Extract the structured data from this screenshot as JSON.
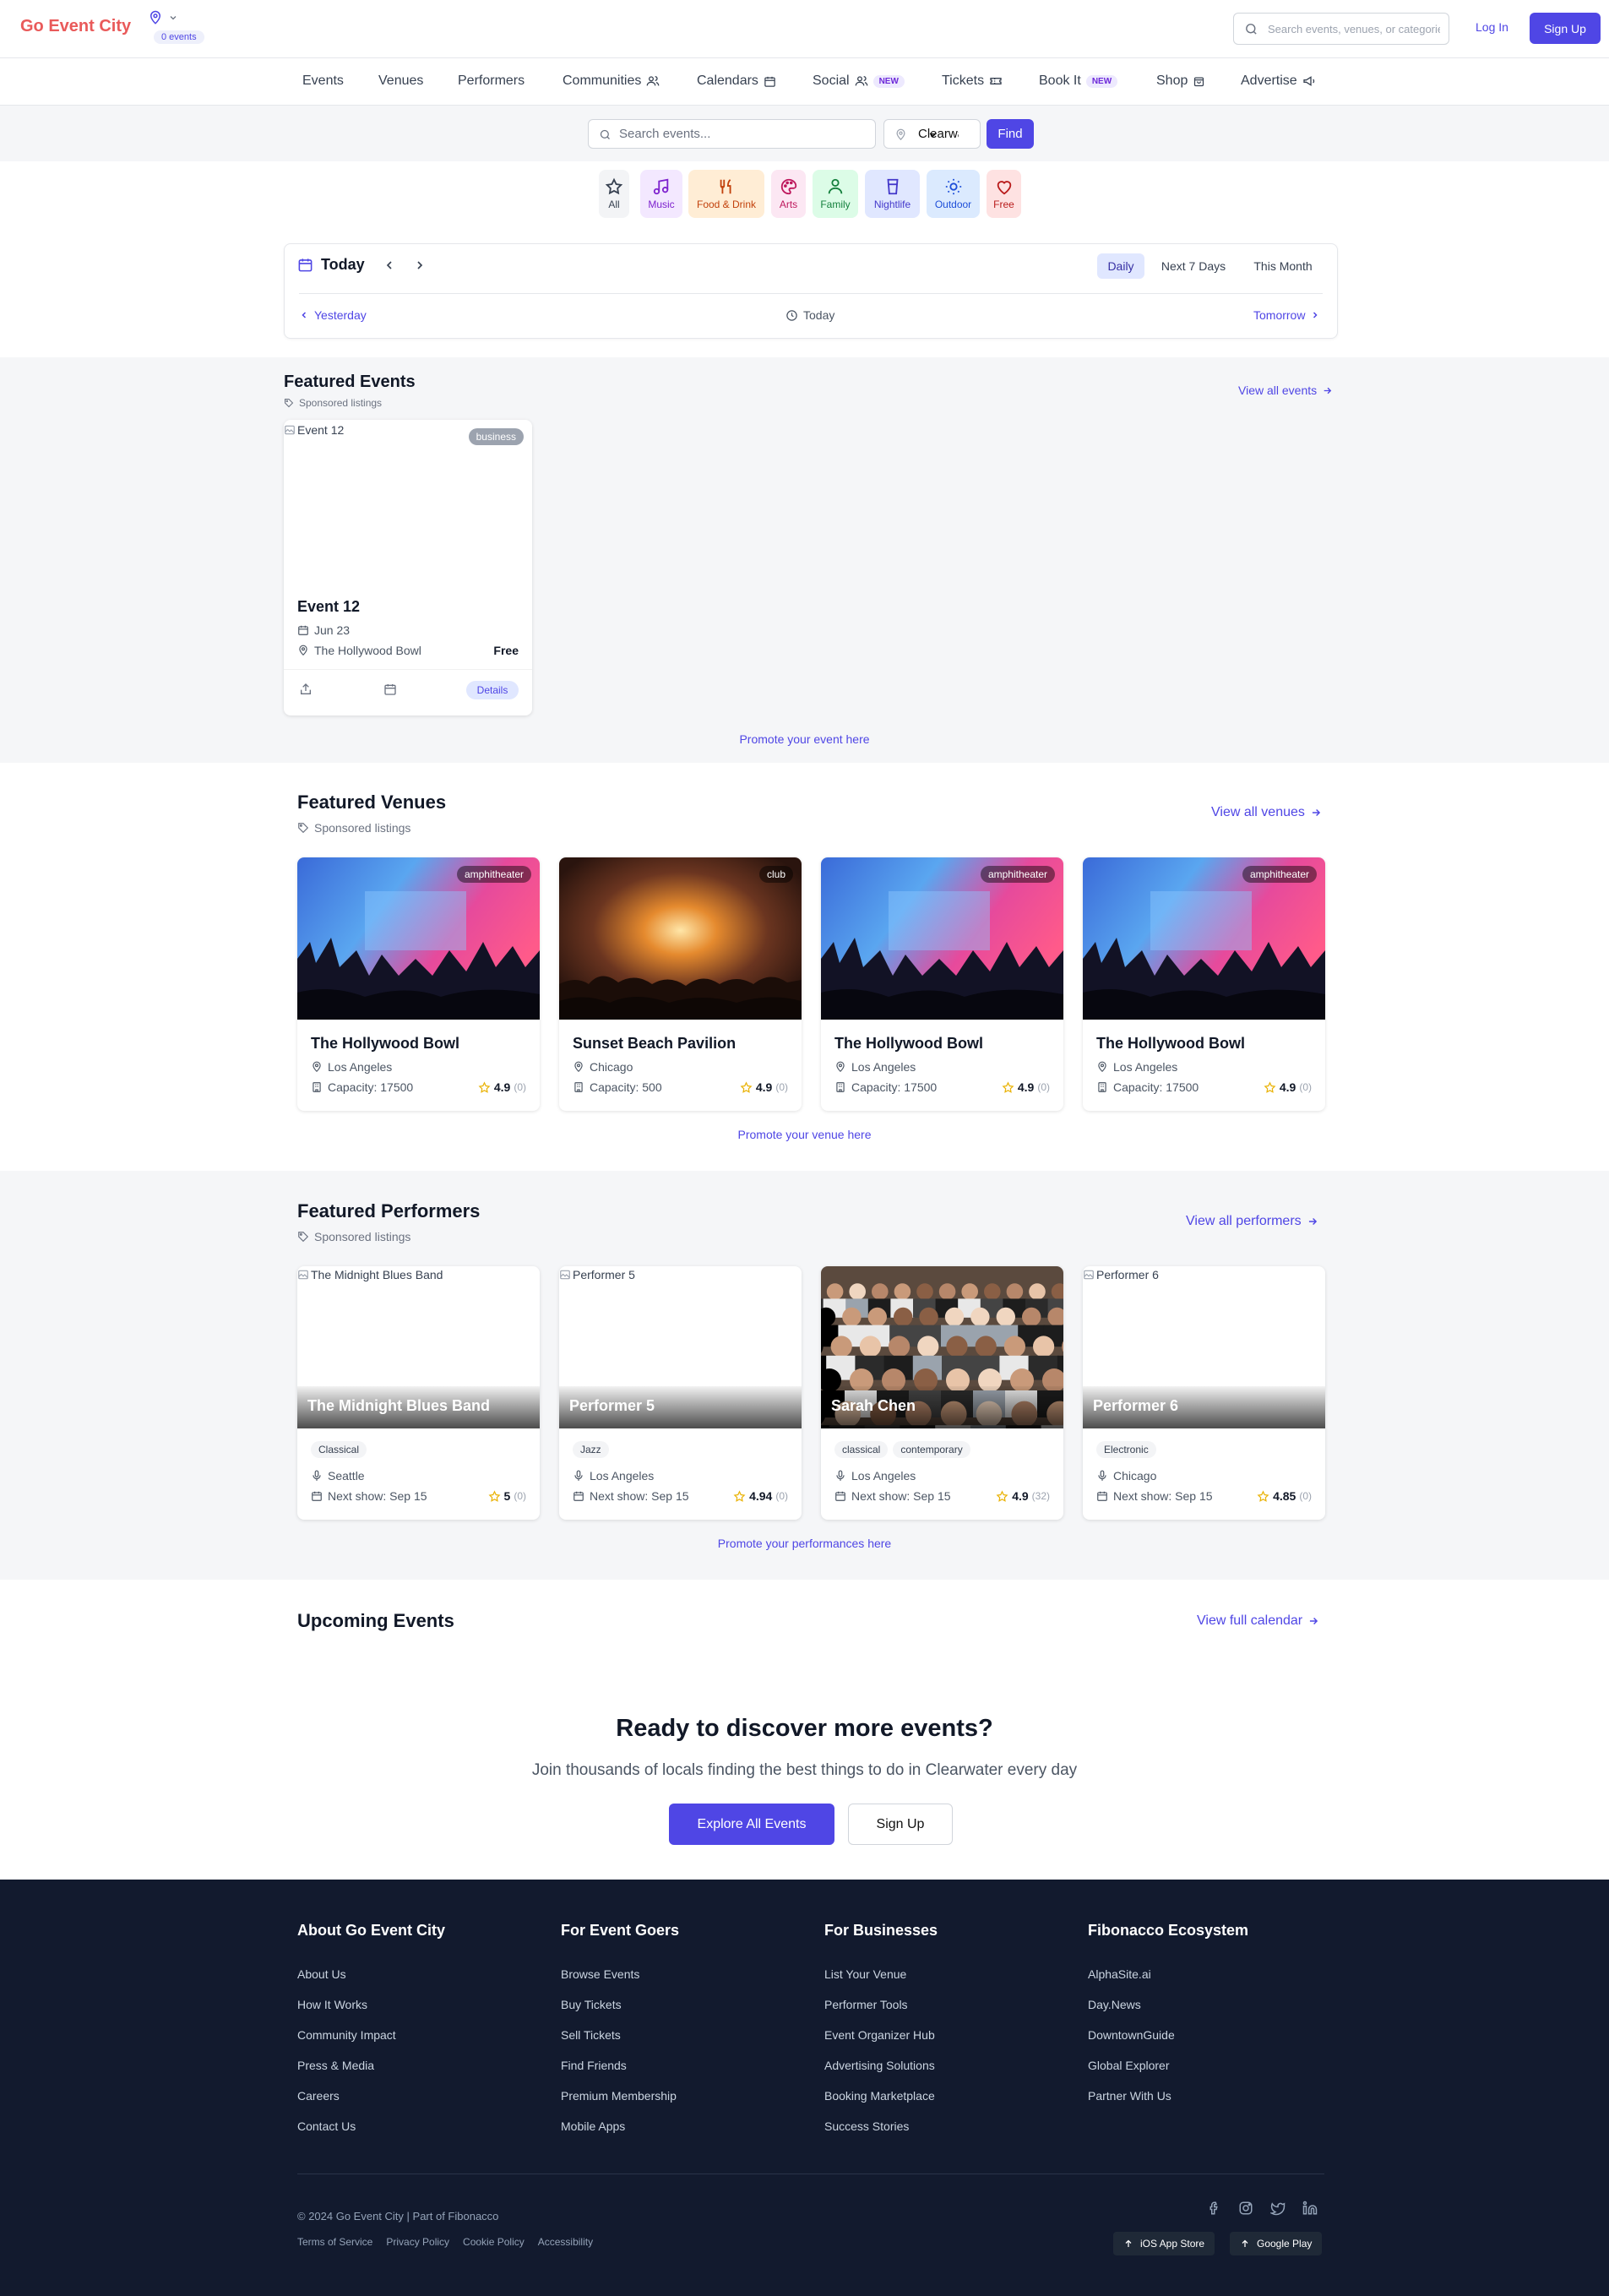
{
  "header": {
    "logo": "Go Event City",
    "events_badge": "0 events",
    "search_placeholder": "Search events, venues, or categories",
    "login": "Log In",
    "signup": "Sign Up"
  },
  "nav": [
    {
      "label": "Events"
    },
    {
      "label": "Venues"
    },
    {
      "label": "Performers"
    },
    {
      "label": "Communities",
      "icon": "users-icon"
    },
    {
      "label": "Calendars",
      "icon": "calendar-icon"
    },
    {
      "label": "Social",
      "icon": "users-icon",
      "badge": "NEW"
    },
    {
      "label": "Tickets",
      "icon": "ticket-icon"
    },
    {
      "label": "Book It",
      "badge": "NEW"
    },
    {
      "label": "Shop",
      "icon": "shop-icon"
    },
    {
      "label": "Advertise",
      "icon": "megaphone-icon"
    }
  ],
  "search": {
    "placeholder": "Search events...",
    "location": "Clearwater",
    "find": "Find"
  },
  "categories": [
    {
      "label": "All",
      "icon": "star-icon",
      "bg": "#f3f4f6",
      "color": "#374151"
    },
    {
      "label": "Music",
      "icon": "music-icon",
      "bg": "#f3e8ff",
      "color": "#7e22ce"
    },
    {
      "label": "Food & Drink",
      "icon": "utensils-icon",
      "bg": "#ffedd5",
      "color": "#c2410c"
    },
    {
      "label": "Arts",
      "icon": "palette-icon",
      "bg": "#fce7f3",
      "color": "#be185d"
    },
    {
      "label": "Family",
      "icon": "person-icon",
      "bg": "#dcfce7",
      "color": "#15803d"
    },
    {
      "label": "Nightlife",
      "icon": "cup-icon",
      "bg": "#e0e7ff",
      "color": "#4338ca"
    },
    {
      "label": "Outdoor",
      "icon": "sun-icon",
      "bg": "#dbeafe",
      "color": "#1d4ed8"
    },
    {
      "label": "Free",
      "icon": "heart-icon",
      "bg": "#fee2e2",
      "color": "#b91c1c"
    }
  ],
  "datebar": {
    "title": "Today",
    "tabs": [
      "Daily",
      "Next 7 Days",
      "This Month"
    ],
    "active_tab": "Daily",
    "prev": "Yesterday",
    "current": "Today",
    "next": "Tomorrow"
  },
  "featured_events": {
    "title": "Featured Events",
    "sponsored": "Sponsored listings",
    "view_all": "View all events",
    "promote": "Promote your event here",
    "items": [
      {
        "image_alt": "Event 12",
        "badge": "business",
        "name": "Event 12",
        "date": "Jun 23",
        "venue": "The Hollywood Bowl",
        "price": "Free",
        "details": "Details"
      }
    ]
  },
  "featured_venues": {
    "title": "Featured Venues",
    "sponsored": "Sponsored listings",
    "view_all": "View all venues",
    "promote": "Promote your venue here",
    "items": [
      {
        "type": "amphitheater",
        "name": "The Hollywood Bowl",
        "city": "Los Angeles",
        "capacity": "Capacity: 17500",
        "rating": "4.9",
        "count": "(0)",
        "image": "concert-stage"
      },
      {
        "type": "club",
        "name": "Sunset Beach Pavilion",
        "city": "Chicago",
        "capacity": "Capacity: 500",
        "rating": "4.9",
        "count": "(0)",
        "image": "concert-warm"
      },
      {
        "type": "amphitheater",
        "name": "The Hollywood Bowl",
        "city": "Los Angeles",
        "capacity": "Capacity: 17500",
        "rating": "4.9",
        "count": "(0)",
        "image": "concert-stage"
      },
      {
        "type": "amphitheater",
        "name": "The Hollywood Bowl",
        "city": "Los Angeles",
        "capacity": "Capacity: 17500",
        "rating": "4.9",
        "count": "(0)",
        "image": "concert-stage"
      }
    ]
  },
  "featured_performers": {
    "title": "Featured Performers",
    "sponsored": "Sponsored listings",
    "view_all": "View all performers",
    "promote": "Promote your performances here",
    "items": [
      {
        "image_alt": "The Midnight Blues Band",
        "name": "The Midnight Blues Band",
        "genres": [
          "Classical"
        ],
        "city": "Seattle",
        "next": "Next show: Sep 15",
        "rating": "5",
        "count": "(0)",
        "photo": false
      },
      {
        "image_alt": "Performer 5",
        "name": "Performer 5",
        "genres": [
          "Jazz"
        ],
        "city": "Los Angeles",
        "next": "Next show: Sep 15",
        "rating": "4.94",
        "count": "(0)",
        "photo": false
      },
      {
        "image_alt": "",
        "name": "Sarah Chen",
        "genres": [
          "classical",
          "contemporary"
        ],
        "city": "Los Angeles",
        "next": "Next show: Sep 15",
        "rating": "4.9",
        "count": "(32)",
        "photo": true
      },
      {
        "image_alt": "Performer 6",
        "name": "Performer 6",
        "genres": [
          "Electronic"
        ],
        "city": "Chicago",
        "next": "Next show: Sep 15",
        "rating": "4.85",
        "count": "(0)",
        "photo": false
      }
    ]
  },
  "upcoming": {
    "title": "Upcoming Events",
    "view_all": "View full calendar"
  },
  "cta": {
    "title": "Ready to discover more events?",
    "subtitle": "Join thousands of locals finding the best things to do in Clearwater every day",
    "primary": "Explore All Events",
    "secondary": "Sign Up"
  },
  "footer": {
    "columns": [
      {
        "title": "About Go Event City",
        "links": [
          "About Us",
          "How It Works",
          "Community Impact",
          "Press & Media",
          "Careers",
          "Contact Us"
        ]
      },
      {
        "title": "For Event Goers",
        "links": [
          "Browse Events",
          "Buy Tickets",
          "Sell Tickets",
          "Find Friends",
          "Premium Membership",
          "Mobile Apps"
        ]
      },
      {
        "title": "For Businesses",
        "links": [
          "List Your Venue",
          "Performer Tools",
          "Event Organizer Hub",
          "Advertising Solutions",
          "Booking Marketplace",
          "Success Stories"
        ]
      },
      {
        "title": "Fibonacco Ecosystem",
        "links": [
          "AlphaSite.ai",
          "Day.News",
          "DowntownGuide",
          "Global Explorer",
          "Partner With Us"
        ]
      }
    ],
    "copyright": "© 2024 Go Event City | Part of Fibonacco",
    "legal": [
      "Terms of Service",
      "Privacy Policy",
      "Cookie Policy",
      "Accessibility"
    ],
    "social": [
      "facebook-icon",
      "instagram-icon",
      "twitter-icon",
      "linkedin-icon"
    ],
    "ios": "iOS App Store",
    "android": "Google Play"
  },
  "colors": {
    "brand": "#e95a5a",
    "accent": "#4f46e5",
    "footer_bg": "#121a2e"
  }
}
